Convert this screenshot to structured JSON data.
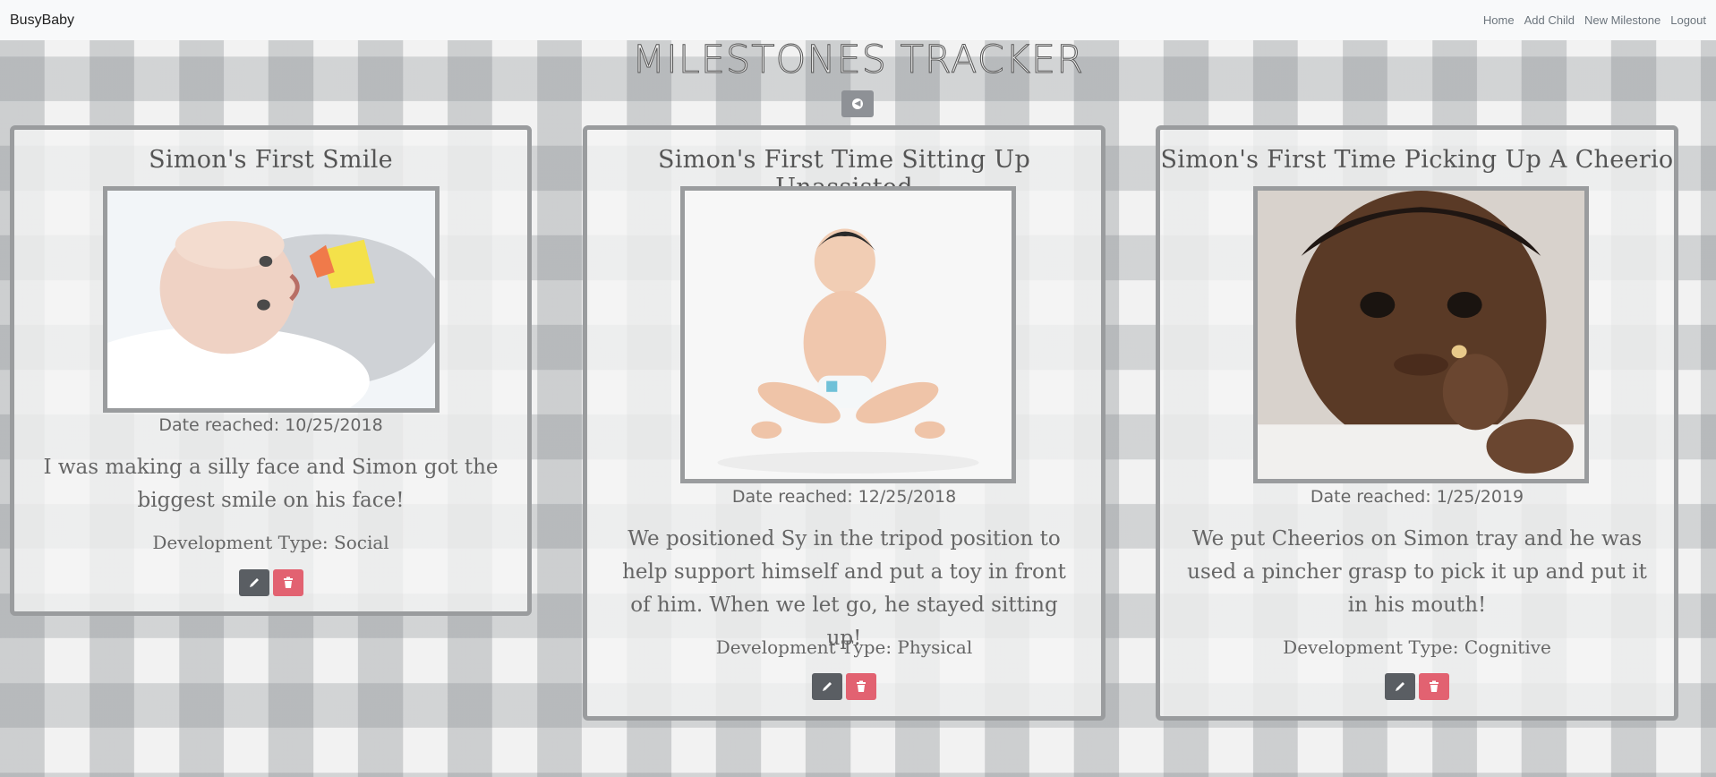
{
  "navbar": {
    "brand": "BusyBaby",
    "links": [
      "Home",
      "Add Child",
      "New Milestone",
      "Logout"
    ]
  },
  "page": {
    "title": "MILESTONES TRACKER",
    "back_icon": "arrow-circle-left-icon"
  },
  "milestones": [
    {
      "title": "Simon's First Smile",
      "date": "Date reached: 10/25/2018",
      "description": "I was making a silly face and Simon got the biggest smile on his face!",
      "dev_type": "Development Type: Social"
    },
    {
      "title": "Simon's First Time Sitting Up Unassisted",
      "date": "Date reached: 12/25/2018",
      "description": "We positioned Sy in the tripod position to help support himself and put a toy in front of him. When we let go, he stayed sitting up!",
      "dev_type": "Development Type: Physical"
    },
    {
      "title": "Simon's First Time Picking Up A Cheerio",
      "date": "Date reached: 1/25/2019",
      "description": "We put Cheerios on Simon tray and he was used a pincher grasp to pick it up and put it in his mouth!",
      "dev_type": "Development Type: Cognitive"
    }
  ],
  "icons": {
    "edit": "pencil-icon",
    "delete": "trash-icon"
  },
  "colors": {
    "frame": "#9a9c9e",
    "edit_button": "#5a5e63",
    "delete_button": "#e26271"
  }
}
